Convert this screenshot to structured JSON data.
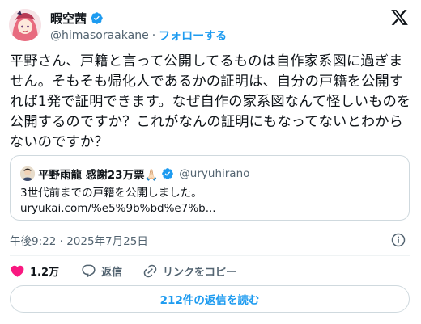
{
  "author": {
    "display_name": "暇空茜",
    "handle": "@himasoraakane",
    "separator": "·",
    "follow_label": "フォローする"
  },
  "tweet": {
    "text": "平野さん、戸籍と言って公開してるものは自作家系図に過ぎません。そもそも帰化人であるかの証明は、自分の戸籍を公開すれば1発で証明できます。なぜ自作の家系図なんて怪しいものを公開するのですか？これがなんの証明にもなってないとわからないのですか？",
    "timestamp": "午後9:22 · 2025年7月25日"
  },
  "quote": {
    "display_name": "平野雨龍 感謝23万票🙏🏻",
    "handle": "@uryuhirano",
    "text": "3世代前までの戸籍を公開しました。",
    "link": "uryukai.com/%e5%9b%bd%e7%b..."
  },
  "actions": {
    "like_count": "1.2万",
    "reply_label": "返信",
    "copy_link_label": "リンクをコピー"
  },
  "replies_button": "212件の返信を読む",
  "colors": {
    "accent": "#1d9bf0",
    "like": "#f91880",
    "text_secondary": "#536471",
    "border": "#cfd9de"
  },
  "icons": [
    "verified-badge-icon",
    "x-logo-icon",
    "info-icon",
    "heart-icon",
    "reply-icon",
    "link-icon"
  ]
}
